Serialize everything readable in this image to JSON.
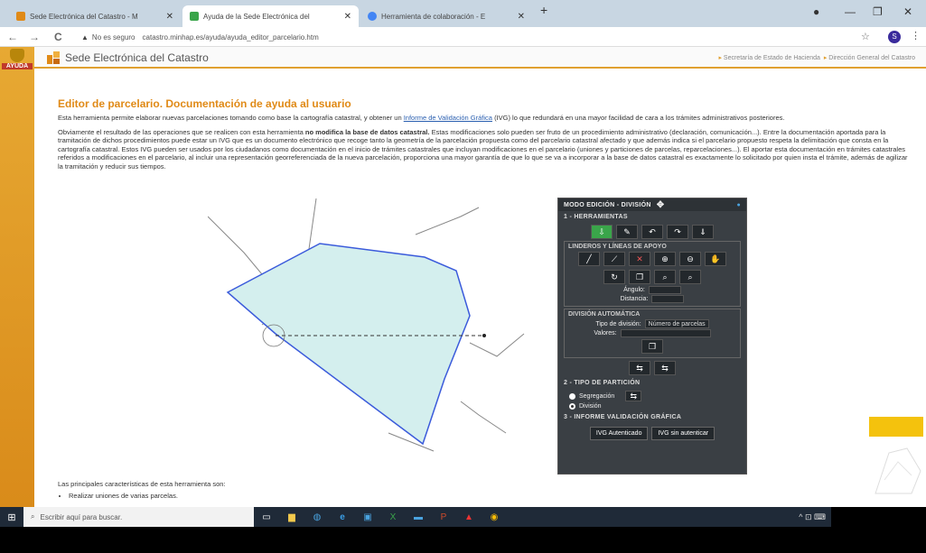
{
  "browser": {
    "tabs": [
      {
        "label": "Sede Electrónica del Catastro - M",
        "favicon_color": "#e08a17"
      },
      {
        "label": "Ayuda de la Sede Electrónica del",
        "favicon_color": "#3aa54a"
      },
      {
        "label": "Herramienta de colaboración - E",
        "favicon_color": "#4285f4"
      }
    ],
    "new_tab": "+",
    "window_controls": [
      "●",
      "—",
      "❐",
      "✕"
    ],
    "nav": {
      "back": "←",
      "forward": "→",
      "reload": "C"
    },
    "address": {
      "warning": "▲",
      "security": "No es seguro",
      "url": "catastro.minhap.es/ayuda/ayuda_editor_parcelario.htm"
    },
    "star": "☆",
    "profile_initial": "S",
    "menu": "⋮"
  },
  "site": {
    "sidebar_label": "AYUDA",
    "title": "Sede Electrónica del Catastro",
    "header_links": [
      "Secretaría de Estado de Hacienda",
      "Dirección General del Catastro"
    ]
  },
  "content": {
    "heading": "Editor de parcelario. Documentación de ayuda al usuario",
    "p1_pre": "Esta herramienta permite elaborar nuevas parcelaciones tomando como base la cartografía catastral, y obtener un",
    "p1_link": "Informe de Validación Gráfica",
    "p1_post": "(IVG) lo que redundará en una mayor facilidad de cara a los trámites administrativos posteriores.",
    "p2_pre": "Obviamente el resultado de las operaciones que se realicen con esta herramienta",
    "p2_bold": "no modifica la base de datos catastral.",
    "p2_post": "Estas modificaciones solo pueden ser fruto de un procedimiento administrativo (declaración, comunicación...). Entre la documentación aportada para la tramitación de dichos procedimientos puede estar un IVG que es un documento electrónico que recoge tanto la geometría de la parcelación propuesta como del parcelario catastral afectado y que además indica si el parcelario propuesto respeta la delimitación que consta en la cartografía catastral. Estos IVG pueden ser usados por los ciudadanos como documentación en el inicio de trámites catastrales que incluyan modificaciones en el parcelario (uniones y particiones de parcelas, reparcelaciones...). El aportar esta documentación en trámites catastrales referidos a modificaciones en el parcelario, al incluir una representación georreferenciada de la nueva parcelación, proporciona una mayor garantía de que lo que se va a incorporar a la base de datos catastral es exactamente lo solicitado por quien insta el trámite, además de agilizar la tramitación y reducir sus tiempos.",
    "below_intro": "Las principales características de esta herramienta son:",
    "below_item": "Realizar uniones de varias parcelas."
  },
  "panel": {
    "title": "MODO EDICIÓN - DIVISIÓN",
    "sec1": "1 - HERRAMIENTAS",
    "linderos": "LINDEROS Y LÍNEAS DE APOYO",
    "angulo": "Ángulo:",
    "distancia": "Distancia:",
    "division_auto": "DIVISIÓN AUTOMÁTICA",
    "tipo_label": "Tipo de división:",
    "tipo_value": "Número de parcelas",
    "valores": "Valores:",
    "sec2": "2 - TIPO DE PARTICIÓN",
    "segregacion": "Segregación",
    "division": "División",
    "sec3": "3 - INFORME VALIDACIÓN GRÁFICA",
    "btn_auth": "IVG Autenticado",
    "btn_noauth": "IVG sin autenticar"
  },
  "taskbar": {
    "search_placeholder": "Escribir aquí para buscar.",
    "tray": "^ ⊡ ⌨"
  },
  "colors": {
    "accent": "#e08a17",
    "parcel_fill": "#d4efee",
    "parcel_stroke": "#3b5bdb"
  }
}
